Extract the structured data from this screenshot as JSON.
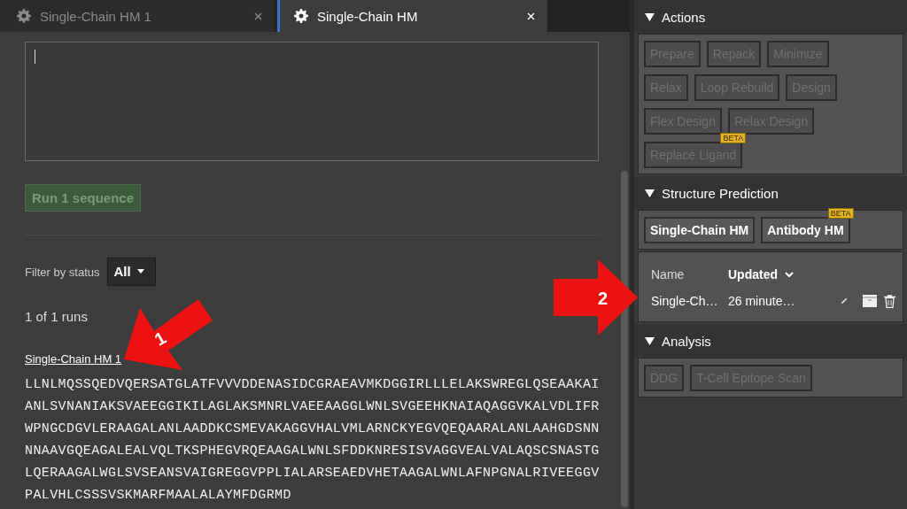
{
  "tabs": [
    {
      "label": "Single-Chain HM 1",
      "selected": false
    },
    {
      "label": "Single-Chain HM",
      "selected": true
    }
  ],
  "run_button": {
    "label": "Run 1 sequence",
    "disabled": true
  },
  "filter": {
    "label": "Filter by status",
    "value": "All"
  },
  "run_count": "1 of 1 runs",
  "run": {
    "name": "Single-Chain HM 1",
    "sequence": [
      "LLNLMQSSQEDVQERSATGLATFVVVDDENASIDCGRAEAVMKDGGIRLLLELAKSWREGLQSEAAKAI",
      "ANLSVNANIAKSVAEEGGIKILAGLAKSMNRLVAEEAAGGLWNLSVGEEHKNAIAQAGGVKALVDLIFR",
      "WPNGCDGVLERAAGALANLAADDKCSMEVAKAGGVHALVMLARNCKYEGVQEQAARALANLAAHGDSNN",
      "NNAAVGQEAGALEALVQLTKSPHEGVRQEAAGALWNLSFDDKNRESISVAGGVEALVALAQSCSNASTG",
      "LQERAAGALWGLSVSEANSVAIGREGGVPPLIALARSEAEDVHETAAGALWNLAFNPGNALRIVEEGGV",
      "PALVHLCSSSVSKMARFMAALALAYMFDGRMD"
    ]
  },
  "panels": [
    {
      "title": "Actions",
      "expanded": true,
      "buttons": [
        {
          "label": "Prepare",
          "disabled": true
        },
        {
          "label": "Repack",
          "disabled": true
        },
        {
          "label": "Minimize",
          "disabled": true
        },
        {
          "label": "Relax",
          "disabled": true
        },
        {
          "label": "Loop Rebuild",
          "disabled": true
        },
        {
          "label": "Design",
          "disabled": true
        },
        {
          "label": "Flex Design",
          "disabled": true
        },
        {
          "label": "Relax Design",
          "disabled": true
        },
        {
          "label": "Replace Ligand",
          "disabled": true,
          "badge": "BETA"
        }
      ]
    },
    {
      "title": "Structure Prediction",
      "expanded": true,
      "buttons": [
        {
          "label": "Single-Chain HM",
          "disabled": false
        },
        {
          "label": "Antibody HM",
          "disabled": false,
          "badge": "BETA"
        }
      ],
      "runs": {
        "columns": [
          "Name",
          "Updated"
        ],
        "rows": [
          {
            "name": "Single-Ch…",
            "updated": "26 minute…"
          }
        ]
      }
    },
    {
      "title": "Analysis",
      "expanded": true,
      "buttons": [
        {
          "label": "DDG",
          "disabled": true
        },
        {
          "label": "T-Cell Epitope Scan",
          "disabled": true
        }
      ]
    }
  ],
  "callouts": [
    {
      "label": "1"
    },
    {
      "label": "2"
    }
  ]
}
